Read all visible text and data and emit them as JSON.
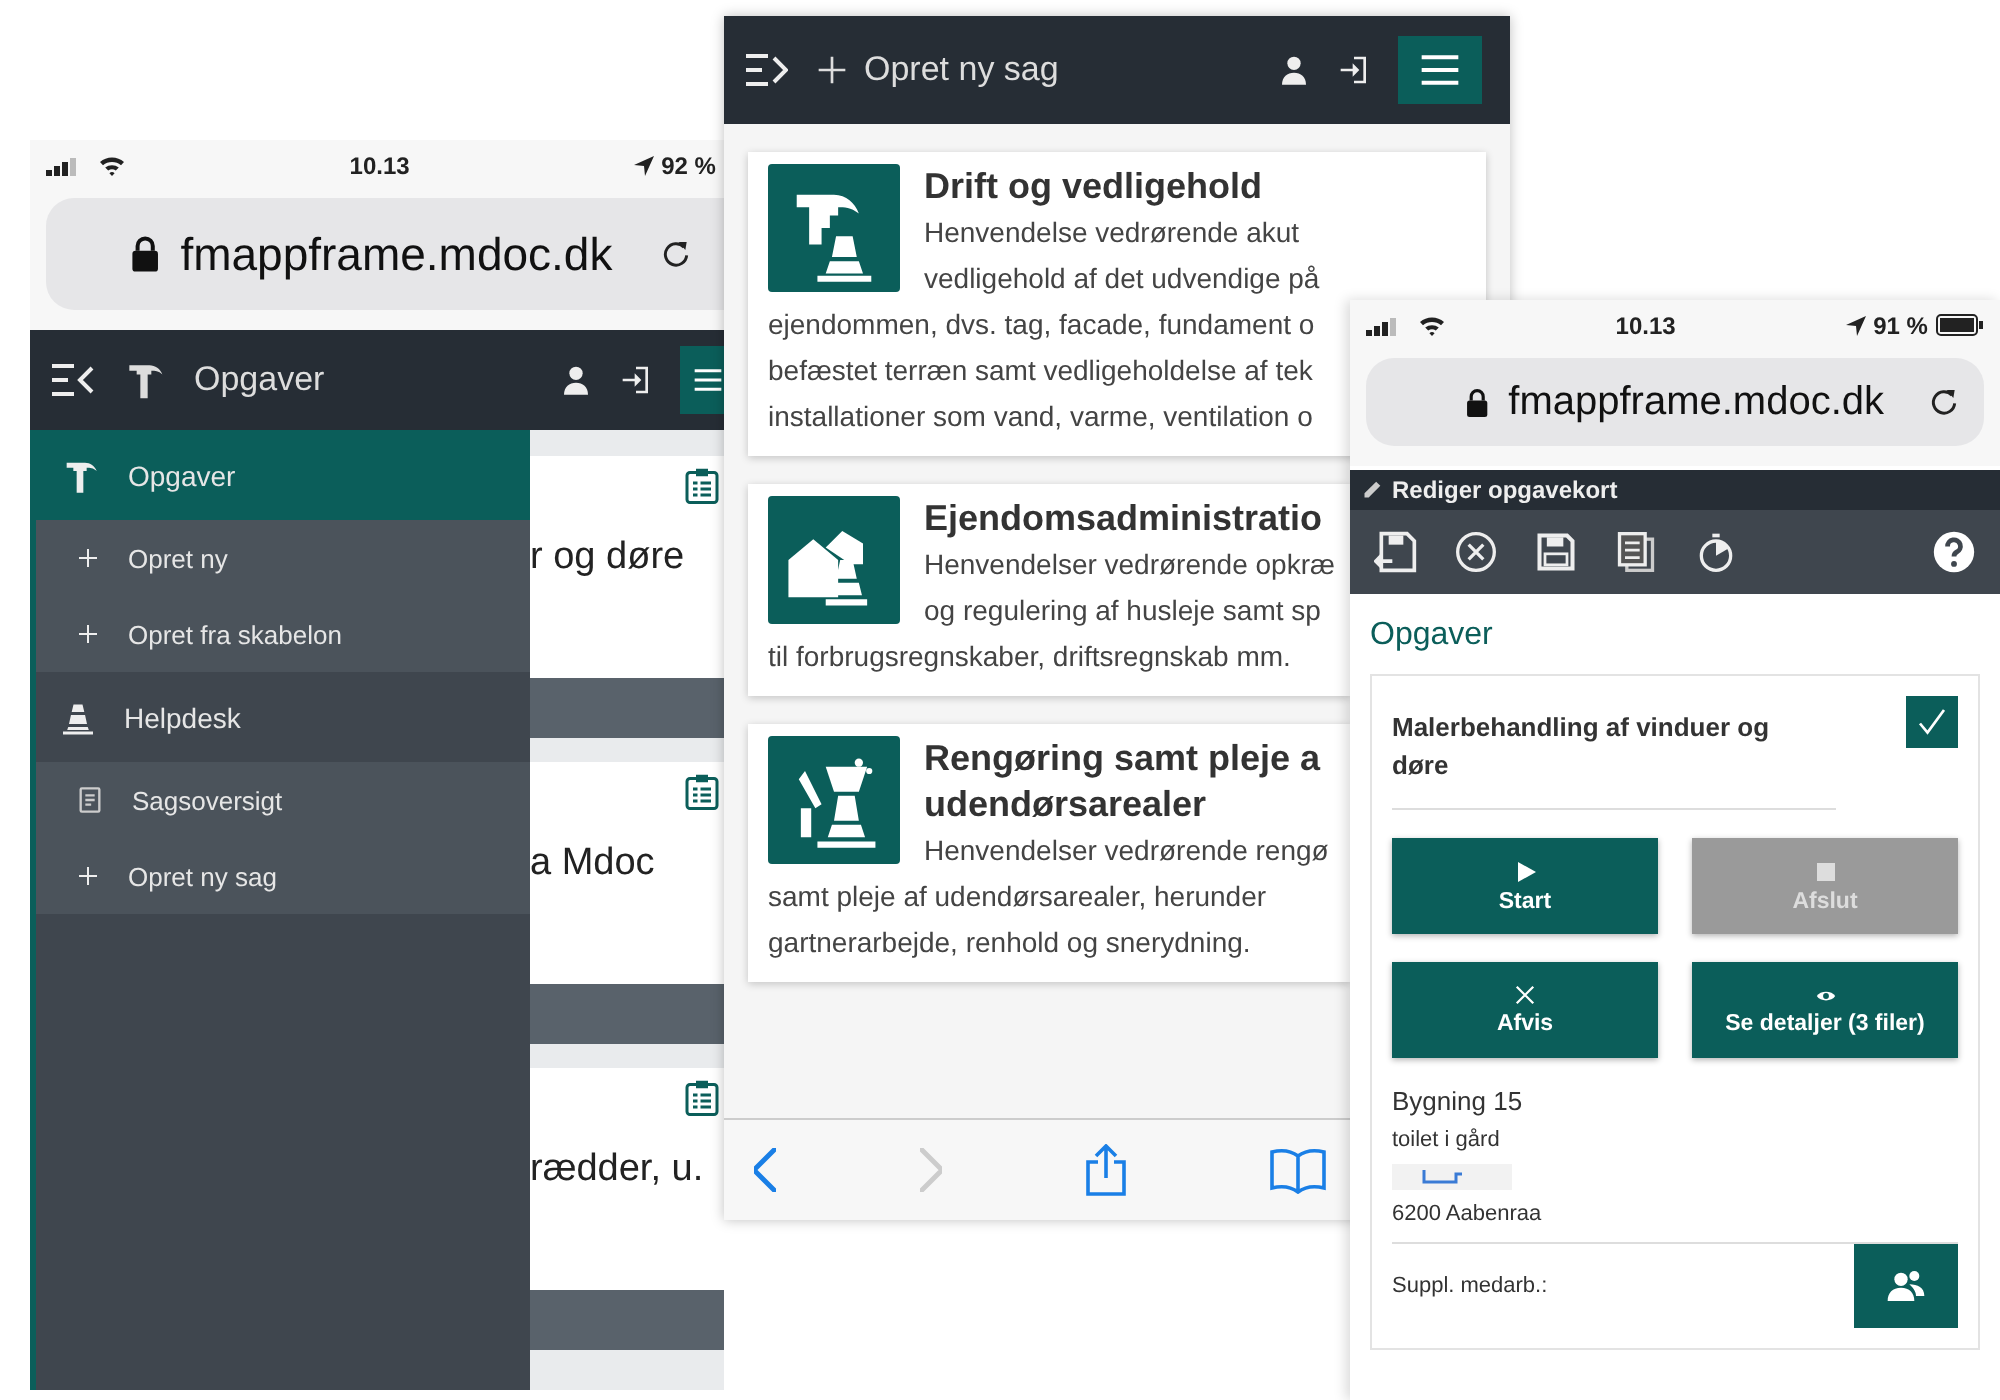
{
  "menu_screen": {
    "status_bar": {
      "time": "10.13",
      "battery": "92 %"
    },
    "address_bar": {
      "url": "fmappframe.mdoc.dk"
    },
    "header": {
      "title": "Opgaver"
    },
    "drawer": {
      "items": [
        {
          "label": "Opgaver",
          "kind": "tasks",
          "selected": true
        },
        {
          "label": "Opret ny",
          "kind": "add",
          "selected": false
        },
        {
          "label": "Opret fra skabelon",
          "kind": "add",
          "selected": false
        },
        {
          "label": "Helpdesk",
          "kind": "helpdesk",
          "selected": false
        },
        {
          "label": "Sagsoversigt",
          "kind": "overview",
          "selected": false
        },
        {
          "label": "Opret ny sag",
          "kind": "add",
          "selected": false
        }
      ]
    },
    "background_cards": [
      {
        "text": "r og døre"
      },
      {
        "text": "a Mdoc"
      },
      {
        "text": "rædder, u."
      }
    ]
  },
  "category_screen": {
    "header": {
      "action": "Opret ny sag"
    },
    "cards": [
      {
        "kind": "maintenance",
        "title_lines": [
          "Drift og vedligehold"
        ],
        "lines": [
          "Henvendelse vedrørende akut",
          "vedligehold af det udvendige på",
          "ejendommen, dvs. tag, facade, fundament o",
          "befæstet terræn samt vedligeholdelse af tek",
          "installationer som vand, varme, ventilation o"
        ]
      },
      {
        "kind": "administration",
        "title_lines": [
          "Ejendomsadministratio"
        ],
        "lines": [
          "Henvendelser vedrørende opkræ",
          "og regulering af husleje samt sp",
          "til forbrugsregnskaber, driftsregnskab mm."
        ]
      },
      {
        "kind": "outdoor",
        "title_lines": [
          "Rengøring samt pleje a",
          "udendørsarealer"
        ],
        "lines": [
          "Henvendelser vedrørende rengø",
          "samt pleje af udendørsarealer, herunder",
          "gartnerarbejde, renhold og snerydning."
        ]
      }
    ],
    "toolbar": {
      "forward_disabled": true
    }
  },
  "task_screen": {
    "status_bar": {
      "time": "10.13",
      "battery": "91 %"
    },
    "address_bar": {
      "url": "fmappframe.mdoc.dk"
    },
    "title_bar": {
      "title": "Rediger opgavekort"
    },
    "section_title": "Opgaver",
    "task": {
      "title": "Malerbehandling af vinduer og døre",
      "checked": true
    },
    "buttons": [
      {
        "label": "Start",
        "kind": "start",
        "disabled": false
      },
      {
        "label": "Afslut",
        "kind": "stop",
        "disabled": true
      },
      {
        "label": "Afvis",
        "kind": "reject",
        "disabled": false
      },
      {
        "label": "Se detaljer (3 filer)",
        "kind": "details",
        "disabled": false
      }
    ],
    "address_lines": [
      "Bygning 15",
      "toilet i gård",
      "6200 Aabenraa"
    ],
    "extra_staff_label": "Suppl. medarb.:"
  }
}
